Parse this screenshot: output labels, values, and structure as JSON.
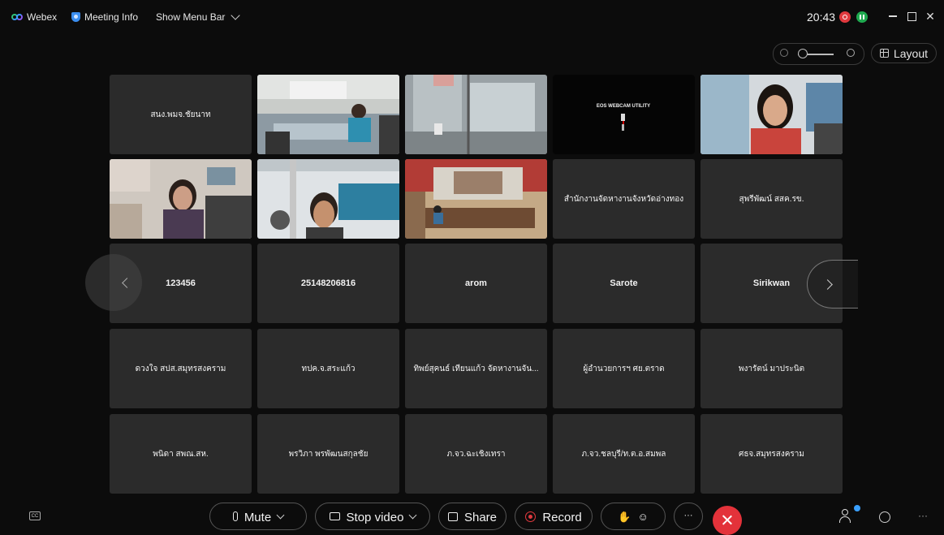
{
  "titlebar": {
    "app_name": "Webex",
    "meeting_info": "Meeting Info",
    "menu_bar": "Show Menu Bar",
    "time": "20:43"
  },
  "layout_label": "Layout",
  "tiles": [
    {
      "name": "สนง.พมจ.ชัยนาท",
      "video": false
    },
    {
      "name": "",
      "video": true,
      "scene": "office-woman-blue"
    },
    {
      "name": "",
      "video": true,
      "scene": "glass-door"
    },
    {
      "name": "",
      "video": true,
      "scene": "eos"
    },
    {
      "name": "",
      "video": true,
      "scene": "woman-close"
    },
    {
      "name": "",
      "video": true,
      "scene": "office-woman-glasses"
    },
    {
      "name": "",
      "video": true,
      "scene": "man-face"
    },
    {
      "name": "",
      "video": true,
      "scene": "meeting-room"
    },
    {
      "name": "สำนักงานจัดหางานจังหวัดอ่างทอง",
      "video": false
    },
    {
      "name": "สุพรีพัฒน์ สสค.รข.",
      "video": false
    },
    {
      "name": "123456",
      "video": false
    },
    {
      "name": "25148206816",
      "video": false
    },
    {
      "name": "arom",
      "video": false
    },
    {
      "name": "Sarote",
      "video": false
    },
    {
      "name": "Sirikwan",
      "video": false
    },
    {
      "name": "ดวงใจ สปส.สมุทรสงคราม",
      "video": false
    },
    {
      "name": "ทปค.จ.สระแก้ว",
      "video": false
    },
    {
      "name": "ทิพย์สุคนธ์ เทียนแก้ว จัดหางานจัน...",
      "video": false
    },
    {
      "name": "ผู้อำนวยการฯ ศย.ตราด",
      "video": false
    },
    {
      "name": "พงารัตน์ มาประนิต",
      "video": false
    },
    {
      "name": "พนิดา สพณ.สห.",
      "video": false
    },
    {
      "name": "พรวิภา พรพัฒนสกุลชัย",
      "video": false
    },
    {
      "name": "ภ.จว.ฉะเชิงเทรา",
      "video": false
    },
    {
      "name": "ภ.จว.ชลบุรี/ท.ต.อ.สมพล",
      "video": false
    },
    {
      "name": "ศธจ.สมุทรสงคราม",
      "video": false
    }
  ],
  "eos_text": "EOS WEBCAM UTILITY",
  "toolbar": {
    "cc": "CC",
    "mute": "Mute",
    "stop_video": "Stop video",
    "share": "Share",
    "record": "Record",
    "more": "···"
  },
  "colors": {
    "background": "#0c0c0c",
    "tile": "#2b2b2b",
    "end_call": "#e3323a",
    "record": "#e0393e",
    "accent_blue": "#3a9cff"
  }
}
